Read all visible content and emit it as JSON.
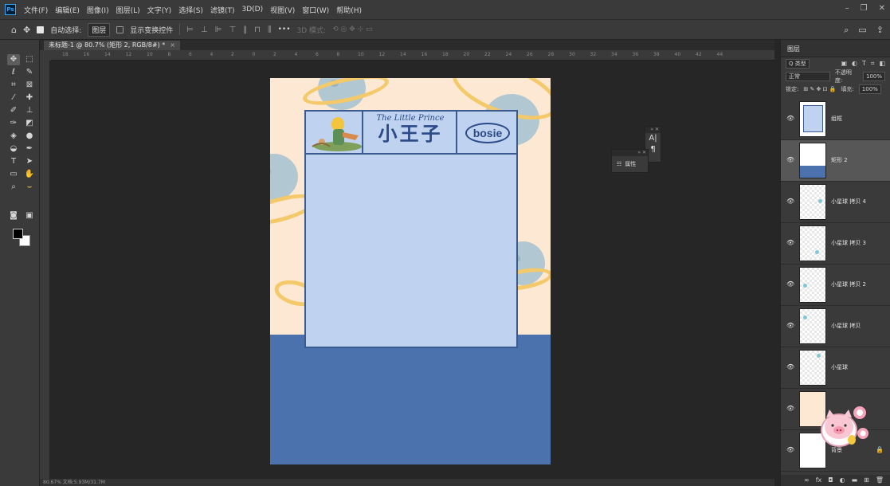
{
  "app": {
    "logo_text": "Ps"
  },
  "menu": [
    "文件(F)",
    "编辑(E)",
    "图像(I)",
    "图层(L)",
    "文字(Y)",
    "选择(S)",
    "滤镜(T)",
    "3D(D)",
    "视图(V)",
    "窗口(W)",
    "帮助(H)"
  ],
  "options": {
    "auto_select_label": "自动选择:",
    "auto_select_value": "图层",
    "show_transform_label": "显示变换控件",
    "mode_3d_label": "3D 模式:",
    "more_label": "•••"
  },
  "document": {
    "tab_title": "未标题-1 @ 80.7% (矩形 2, RGB/8#) *",
    "status_text": "80.67%    文档:5.93M/31.7M"
  },
  "ruler_numbers": [
    "18",
    "16",
    "14",
    "12",
    "10",
    "8",
    "6",
    "4",
    "2",
    "0",
    "2",
    "4",
    "6",
    "8",
    "10",
    "12",
    "14",
    "16",
    "18",
    "20",
    "22",
    "24",
    "26",
    "28",
    "30",
    "32",
    "34",
    "36",
    "38",
    "40",
    "42",
    "44"
  ],
  "artwork": {
    "title_en": "The Little Prince",
    "title_cn": "小王子",
    "brand": "bosie",
    "colors": {
      "background": "#fde8d3",
      "card": "#bfd3f1",
      "band": "#4c72ae",
      "border": "#3b5a8f"
    }
  },
  "floating": {
    "char_icon": "A|",
    "para_icon": "¶",
    "properties_label": "属性"
  },
  "layers_panel": {
    "tab_label": "图层",
    "filter_label": "Q 类型",
    "blend_mode": "正常",
    "opacity_label": "不透明度:",
    "opacity_value": "100%",
    "lock_label": "锁定:",
    "fill_label": "填充:",
    "fill_value": "100%",
    "layers": [
      {
        "name": "组框",
        "selected": false
      },
      {
        "name": "矩形 2",
        "selected": true
      },
      {
        "name": "小星球 拷贝 4",
        "selected": false
      },
      {
        "name": "小星球 拷贝 3",
        "selected": false
      },
      {
        "name": "小星球 拷贝 2",
        "selected": false
      },
      {
        "name": "小星球 拷贝",
        "selected": false
      },
      {
        "name": "小星球",
        "selected": false
      },
      {
        "name": "",
        "selected": false
      },
      {
        "name": "背景",
        "selected": false
      }
    ]
  }
}
